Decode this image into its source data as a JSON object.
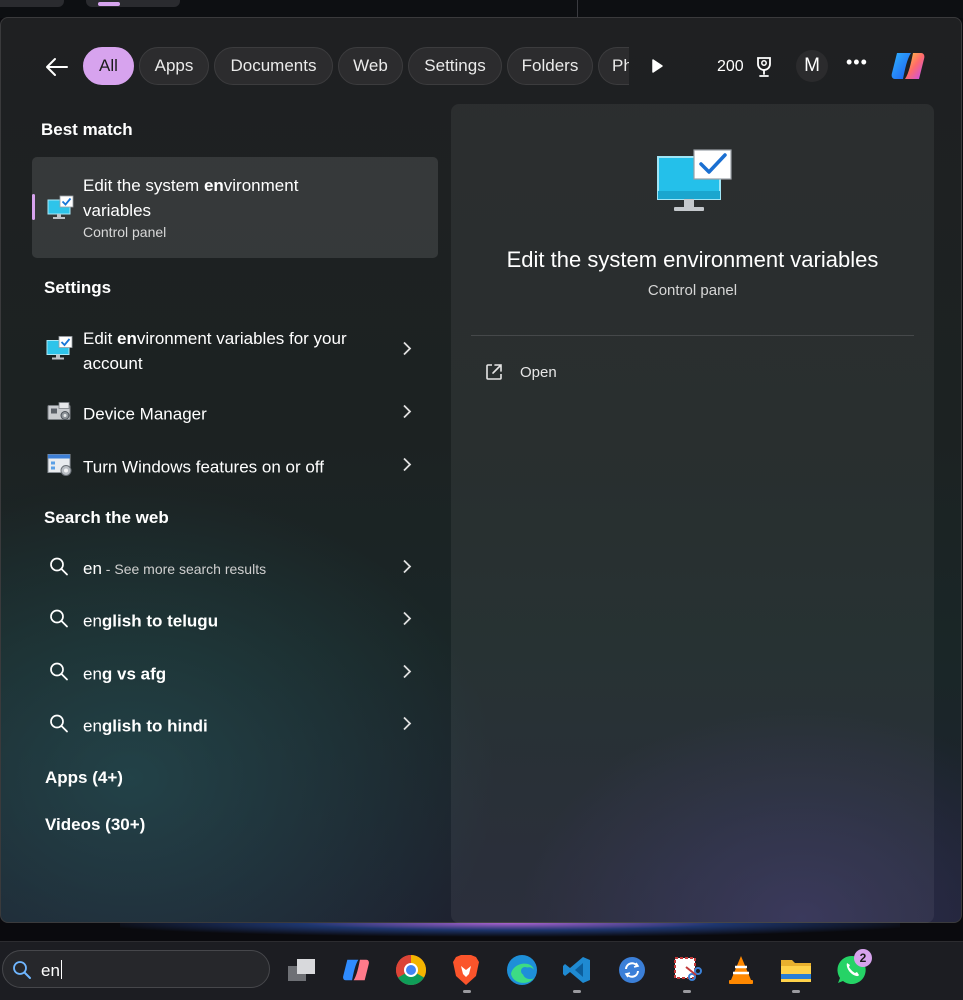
{
  "filters": {
    "back_label": "Back",
    "chips": [
      "All",
      "Apps",
      "Documents",
      "Web",
      "Settings",
      "Folders",
      "Ph"
    ],
    "active": "All",
    "points": "200",
    "avatar_initial": "M",
    "more": "•••"
  },
  "best_match": {
    "section": "Best match",
    "title": "Edit the system environment variables",
    "title_html_parts": [
      "Edit the system ",
      "en",
      "vironment variables"
    ],
    "subtitle": "Control panel",
    "icon": "environment-variables-icon"
  },
  "settings": {
    "section": "Settings",
    "items": [
      {
        "pre": "Edit ",
        "bold": "en",
        "post": "vironment variables for your account",
        "icon": "environment-variables-icon"
      },
      {
        "pre": "Device Manager",
        "bold": "",
        "post": "",
        "icon": "device-manager-icon"
      },
      {
        "pre": "Turn Windows features on or off",
        "bold": "",
        "post": "",
        "icon": "windows-features-icon"
      }
    ]
  },
  "web": {
    "section": "Search the web",
    "items": [
      {
        "query": "en",
        "suffix": " - See more search results"
      },
      {
        "query": "english to telugu",
        "suffix": ""
      },
      {
        "query": "eng vs afg",
        "suffix": ""
      },
      {
        "query": "english to hindi",
        "suffix": ""
      }
    ]
  },
  "more_sections": {
    "apps": "Apps (4+)",
    "videos": "Videos (30+)"
  },
  "preview": {
    "title": "Edit the system environment variables",
    "subtitle": "Control panel",
    "action_open": "Open"
  },
  "taskbar": {
    "search_query": "en",
    "apps": [
      "task-view-icon",
      "copilot-icon",
      "chrome-icon",
      "brave-icon",
      "edge-icon",
      "vscode-icon",
      "sync-icon",
      "snipping-tool-icon",
      "vlc-icon",
      "file-explorer-icon",
      "whatsapp-icon"
    ],
    "whatsapp_badge": "2"
  },
  "colors": {
    "accent": "#d7a3ee",
    "panel": "#1f2022"
  }
}
